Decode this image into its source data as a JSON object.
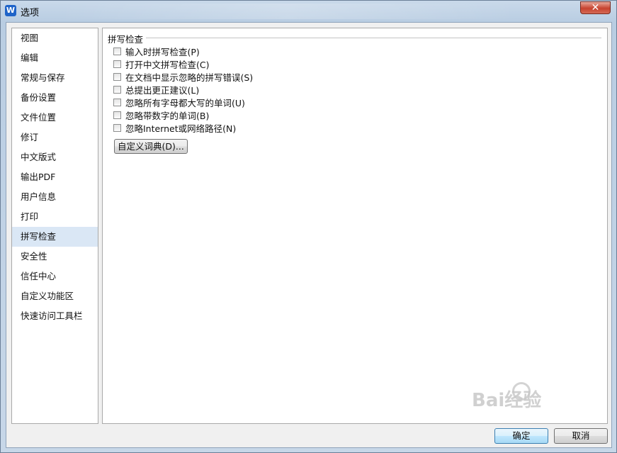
{
  "window": {
    "title": "选项",
    "app_icon_glyph": "W",
    "close_symbol": "✕"
  },
  "sidebar": {
    "items": [
      {
        "label": "视图"
      },
      {
        "label": "编辑"
      },
      {
        "label": "常规与保存"
      },
      {
        "label": "备份设置"
      },
      {
        "label": "文件位置"
      },
      {
        "label": "修订"
      },
      {
        "label": "中文版式"
      },
      {
        "label": "输出PDF"
      },
      {
        "label": "用户信息"
      },
      {
        "label": "打印"
      },
      {
        "label": "拼写检查",
        "selected": true
      },
      {
        "label": "安全性"
      },
      {
        "label": "信任中心"
      },
      {
        "label": "自定义功能区"
      },
      {
        "label": "快速访问工具栏"
      }
    ]
  },
  "panel": {
    "group_title": "拼写检查",
    "options": [
      {
        "label": "输入时拼写检查(P)",
        "checked": false
      },
      {
        "label": "打开中文拼写检查(C)",
        "checked": false
      },
      {
        "label": "在文档中显示忽略的拼写错误(S)",
        "checked": false
      },
      {
        "label": "总提出更正建议(L)",
        "checked": false
      },
      {
        "label": "忽略所有字母都大写的单词(U)",
        "checked": false
      },
      {
        "label": "忽略带数字的单词(B)",
        "checked": false
      },
      {
        "label": "忽略Internet或网络路径(N)",
        "checked": false
      }
    ],
    "dictionary_button": "自定义词典(D)..."
  },
  "footer": {
    "ok_label": "确定",
    "cancel_label": "取消"
  },
  "watermark": {
    "text": "Bai经验"
  }
}
